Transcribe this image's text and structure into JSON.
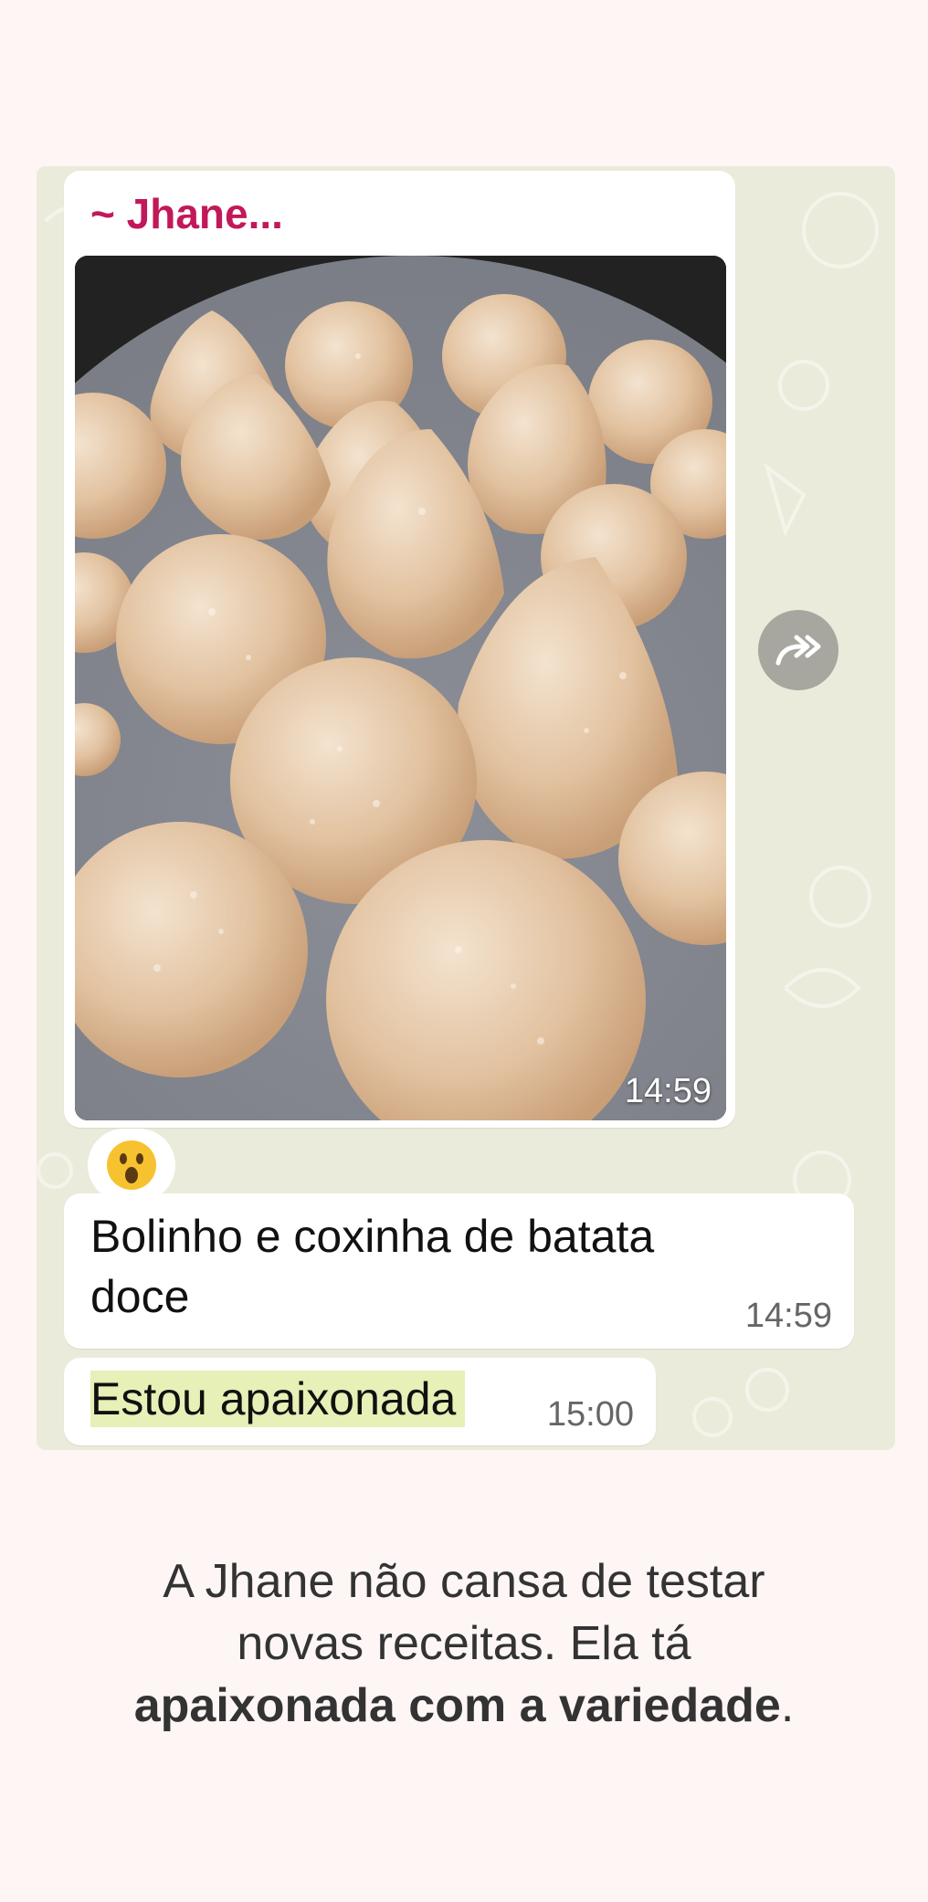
{
  "chat": {
    "sender_name": "~ Jhane...",
    "image_time": "14:59",
    "reaction_emoji": "😮",
    "forward_icon": "forward-icon",
    "message_1": {
      "text": "Bolinho e coxinha de batata doce",
      "time": "14:59"
    },
    "message_2": {
      "text": "Estou apaixonada",
      "time": "15:00"
    }
  },
  "caption": {
    "line_1": "A Jhane não cansa de testar",
    "line_2": "novas receitas. Ela tá",
    "bold_text": "apaixonada com a variedade",
    "trailing": "."
  },
  "colors": {
    "page_background": "#fdf6f5",
    "chat_background": "#ebebdc",
    "sender_name": "#c2185b",
    "highlight": "#e7f0b6"
  }
}
